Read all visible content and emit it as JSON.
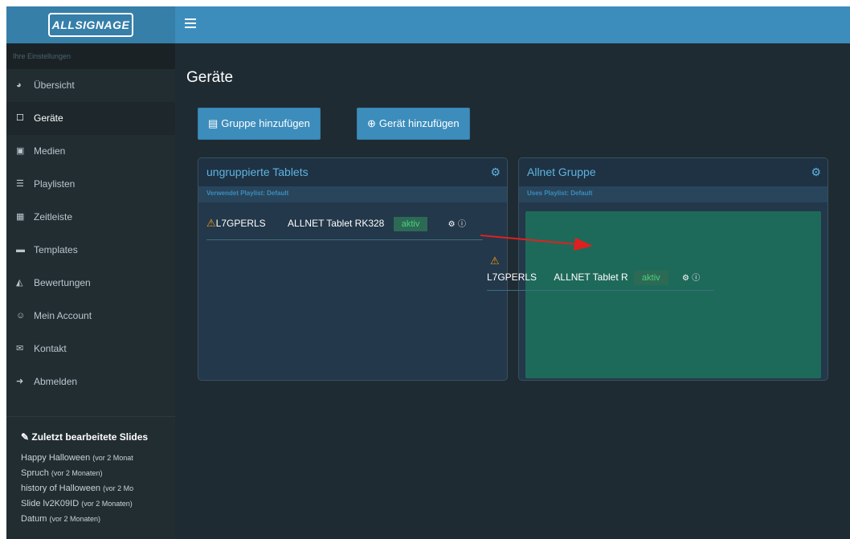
{
  "app": {
    "logo_text": "ALLSIGNAGE"
  },
  "sidebar": {
    "settings_header": "Ihre Einstellungen",
    "items": [
      {
        "label": "Übersicht",
        "icon": "pie-chart-icon",
        "glyph": "◕"
      },
      {
        "label": "Geräte",
        "icon": "tablet-icon",
        "glyph": "☐"
      },
      {
        "label": "Medien",
        "icon": "image-icon",
        "glyph": "▣"
      },
      {
        "label": "Playlisten",
        "icon": "list-icon",
        "glyph": "☰"
      },
      {
        "label": "Zeitleiste",
        "icon": "calendar-icon",
        "glyph": "▦"
      },
      {
        "label": "Templates",
        "icon": "folder-icon",
        "glyph": "▬"
      },
      {
        "label": "Bewertungen",
        "icon": "area-chart-icon",
        "glyph": "◭"
      },
      {
        "label": "Mein Account",
        "icon": "user-circle-icon",
        "glyph": "☺"
      },
      {
        "label": "Kontakt",
        "icon": "envelope-icon",
        "glyph": "✉"
      },
      {
        "label": "Abmelden",
        "icon": "sign-out-icon",
        "glyph": "➜"
      }
    ],
    "recent": {
      "title": "Zuletzt bearbeitete Slides",
      "items": [
        {
          "name": "Happy Halloween",
          "when": "(vor 2 Monat"
        },
        {
          "name": "Spruch",
          "when": "(vor 2 Monaten)"
        },
        {
          "name": "history of Halloween",
          "when": "(vor 2 Mo"
        },
        {
          "name": "Slide lv2K09ID",
          "when": "(vor 2 Monaten)"
        },
        {
          "name": "Datum",
          "when": "(vor 2 Monaten)"
        }
      ]
    }
  },
  "main": {
    "title": "Geräte",
    "buttons": {
      "add_group": "Gruppe hinzufügen",
      "add_device": "Gerät hinzufügen"
    },
    "panels": [
      {
        "title": "ungruppierte Tablets",
        "playlist": "Verwendet Playlist: Default",
        "devices": [
          {
            "id": "L7GPERLS",
            "name": "ALLNET Tablet RK328",
            "status": "aktiv"
          }
        ]
      },
      {
        "title": "Allnet Gruppe",
        "playlist": "Uses Playlist: Default",
        "devices": []
      }
    ],
    "dragged_device": {
      "id": "L7GPERLS",
      "name": "ALLNET Tablet R",
      "status": "aktiv"
    }
  },
  "colors": {
    "topbar": "#3c8dbc",
    "sidebar": "#222d32",
    "content_bg": "#1f2b33",
    "dropzone": "#1e6a5a",
    "warning": "#f39c12",
    "arrow": "#e02020"
  }
}
